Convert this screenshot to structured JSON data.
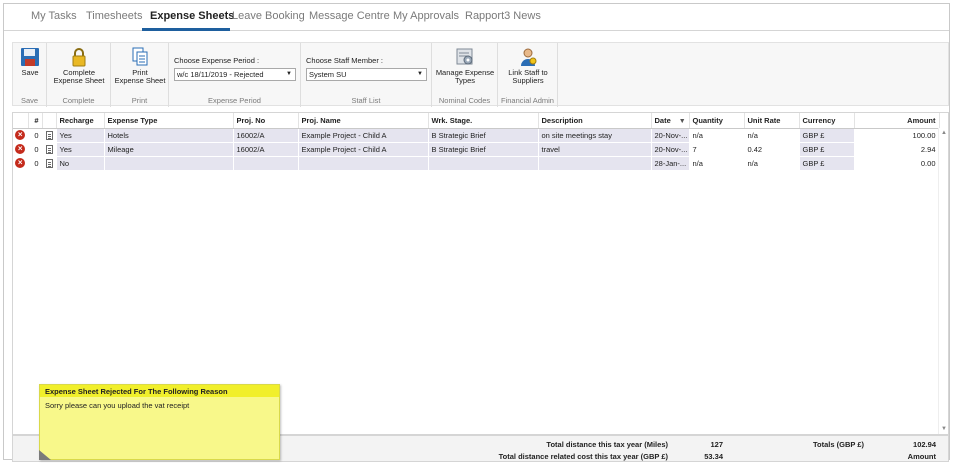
{
  "tabs": [
    "My Tasks",
    "Timesheets",
    "Expense Sheets",
    "Leave Booking",
    "Message Centre",
    "My Approvals",
    "Rapport3 News"
  ],
  "active_tab": "Expense Sheets",
  "ribbon": {
    "save": {
      "label": "Save",
      "group": "Save"
    },
    "complete": {
      "label1": "Complete",
      "label2": "Expense Sheet",
      "group": "Complete"
    },
    "print": {
      "label1": "Print",
      "label2": "Expense Sheet",
      "group": "Print"
    },
    "period": {
      "label": "Choose Expense Period :",
      "value": "w/c 18/11/2019 - Rejected",
      "group": "Expense Period"
    },
    "staff": {
      "label": "Choose Staff Member :",
      "value": "System SU",
      "group": "Staff List"
    },
    "manage": {
      "label1": "Manage Expense",
      "label2": "Types",
      "group": "Nominal Codes"
    },
    "link": {
      "label1": "Link Staff to",
      "label2": "Suppliers",
      "group": "Financial Admin"
    }
  },
  "columns": [
    "#",
    "Recharge",
    "Expense Type",
    "Proj. No",
    "Proj. Name",
    "Wrk. Stage.",
    "Description",
    "Date",
    "Quantity",
    "Unit Rate",
    "Currency",
    "Amount"
  ],
  "rows": [
    {
      "num": "0",
      "recharge": "Yes",
      "type": "Hotels",
      "proj_no": "16002/A",
      "proj_name": "Example Project - Child A",
      "stage": "B Strategic Brief",
      "desc": "on site meetings stay",
      "date": "20-Nov-...",
      "qty": "n/a",
      "rate": "n/a",
      "currency": "GBP £",
      "amount": "100.00"
    },
    {
      "num": "0",
      "recharge": "Yes",
      "type": "Mileage",
      "proj_no": "16002/A",
      "proj_name": "Example Project - Child A",
      "stage": "B Strategic Brief",
      "desc": "travel",
      "date": "20-Nov-...",
      "qty": "7",
      "rate": "0.42",
      "currency": "GBP £",
      "amount": "2.94"
    },
    {
      "num": "0",
      "recharge": "No",
      "type": "",
      "proj_no": "",
      "proj_name": "",
      "stage": "",
      "desc": "",
      "date": "28-Jan-...",
      "qty": "n/a",
      "rate": "n/a",
      "currency": "GBP £",
      "amount": "0.00"
    }
  ],
  "footer": {
    "miles_label": "Total distance this tax year (Miles)",
    "miles_value": "127",
    "cost_label": "Total distance related cost this tax year (GBP £)",
    "cost_value": "53.34",
    "totals_label": "Totals (GBP £)",
    "totals_value": "102.94",
    "amount_label": "Amount"
  },
  "note": {
    "title": "Expense Sheet Rejected For The Following Reason",
    "body": "Sorry please can you upload the vat receipt"
  },
  "colors": {
    "accent": "#1e5f9e",
    "row": "#e5e4ef",
    "note": "#f8f88a",
    "note_header": "#f1ef2b",
    "delete": "#c42b1c"
  }
}
